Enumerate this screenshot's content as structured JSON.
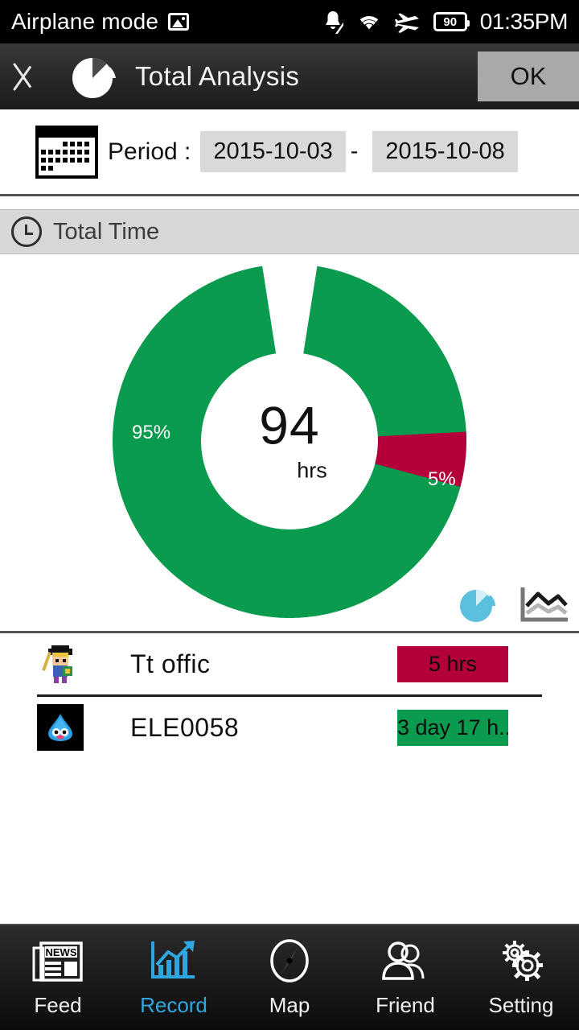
{
  "status_bar": {
    "left_text": "Airplane mode",
    "left_icon": "image-icon",
    "icons": [
      "notification-muted-icon",
      "wifi-icon",
      "airplane-icon"
    ],
    "battery_level": "90",
    "clock": "01:35PM"
  },
  "header": {
    "back_icon": "back-chevron-icon",
    "logo_icon": "pie-chart-logo-icon",
    "title": "Total Analysis",
    "ok_label": "OK"
  },
  "period": {
    "calendar_icon": "calendar-icon",
    "label": "Period :",
    "start_date": "2015-10-03",
    "separator": "-",
    "end_date": "2015-10-08"
  },
  "section": {
    "clock_icon": "clock-icon",
    "title": "Total Time"
  },
  "chart_data": {
    "type": "pie",
    "title": "Total Time",
    "center_value": "94",
    "center_unit": "hrs",
    "categories": [
      "ELE0058",
      "Tt offic"
    ],
    "values": [
      95,
      5
    ],
    "labels": [
      "95%",
      "5%"
    ],
    "colors": [
      "#0a9b4e",
      "#b3003a"
    ],
    "donut": true,
    "legend": "none"
  },
  "chart_toggles": [
    {
      "name": "pie-chart-toggle",
      "selected": true,
      "color": "#5bc0de"
    },
    {
      "name": "line-chart-toggle",
      "selected": false,
      "color": "#8a8a8a"
    }
  ],
  "list": {
    "rows": [
      {
        "avatar": "hero-avatar-icon",
        "name": "Tt offic",
        "badge": "5 hrs",
        "badge_color": "#b3003a"
      },
      {
        "avatar": "slime-avatar-icon",
        "name": "ELE0058",
        "badge": "3 day 17 h...",
        "badge_color": "#0a9b4e"
      }
    ]
  },
  "bottom_nav": {
    "items": [
      {
        "icon": "newspaper-icon",
        "label": "Feed",
        "active": false
      },
      {
        "icon": "chart-growth-icon",
        "label": "Record",
        "active": true
      },
      {
        "icon": "compass-icon",
        "label": "Map",
        "active": false
      },
      {
        "icon": "people-icon",
        "label": "Friend",
        "active": false
      },
      {
        "icon": "gears-icon",
        "label": "Setting",
        "active": false
      }
    ],
    "active_color": "#2ea6e0"
  }
}
